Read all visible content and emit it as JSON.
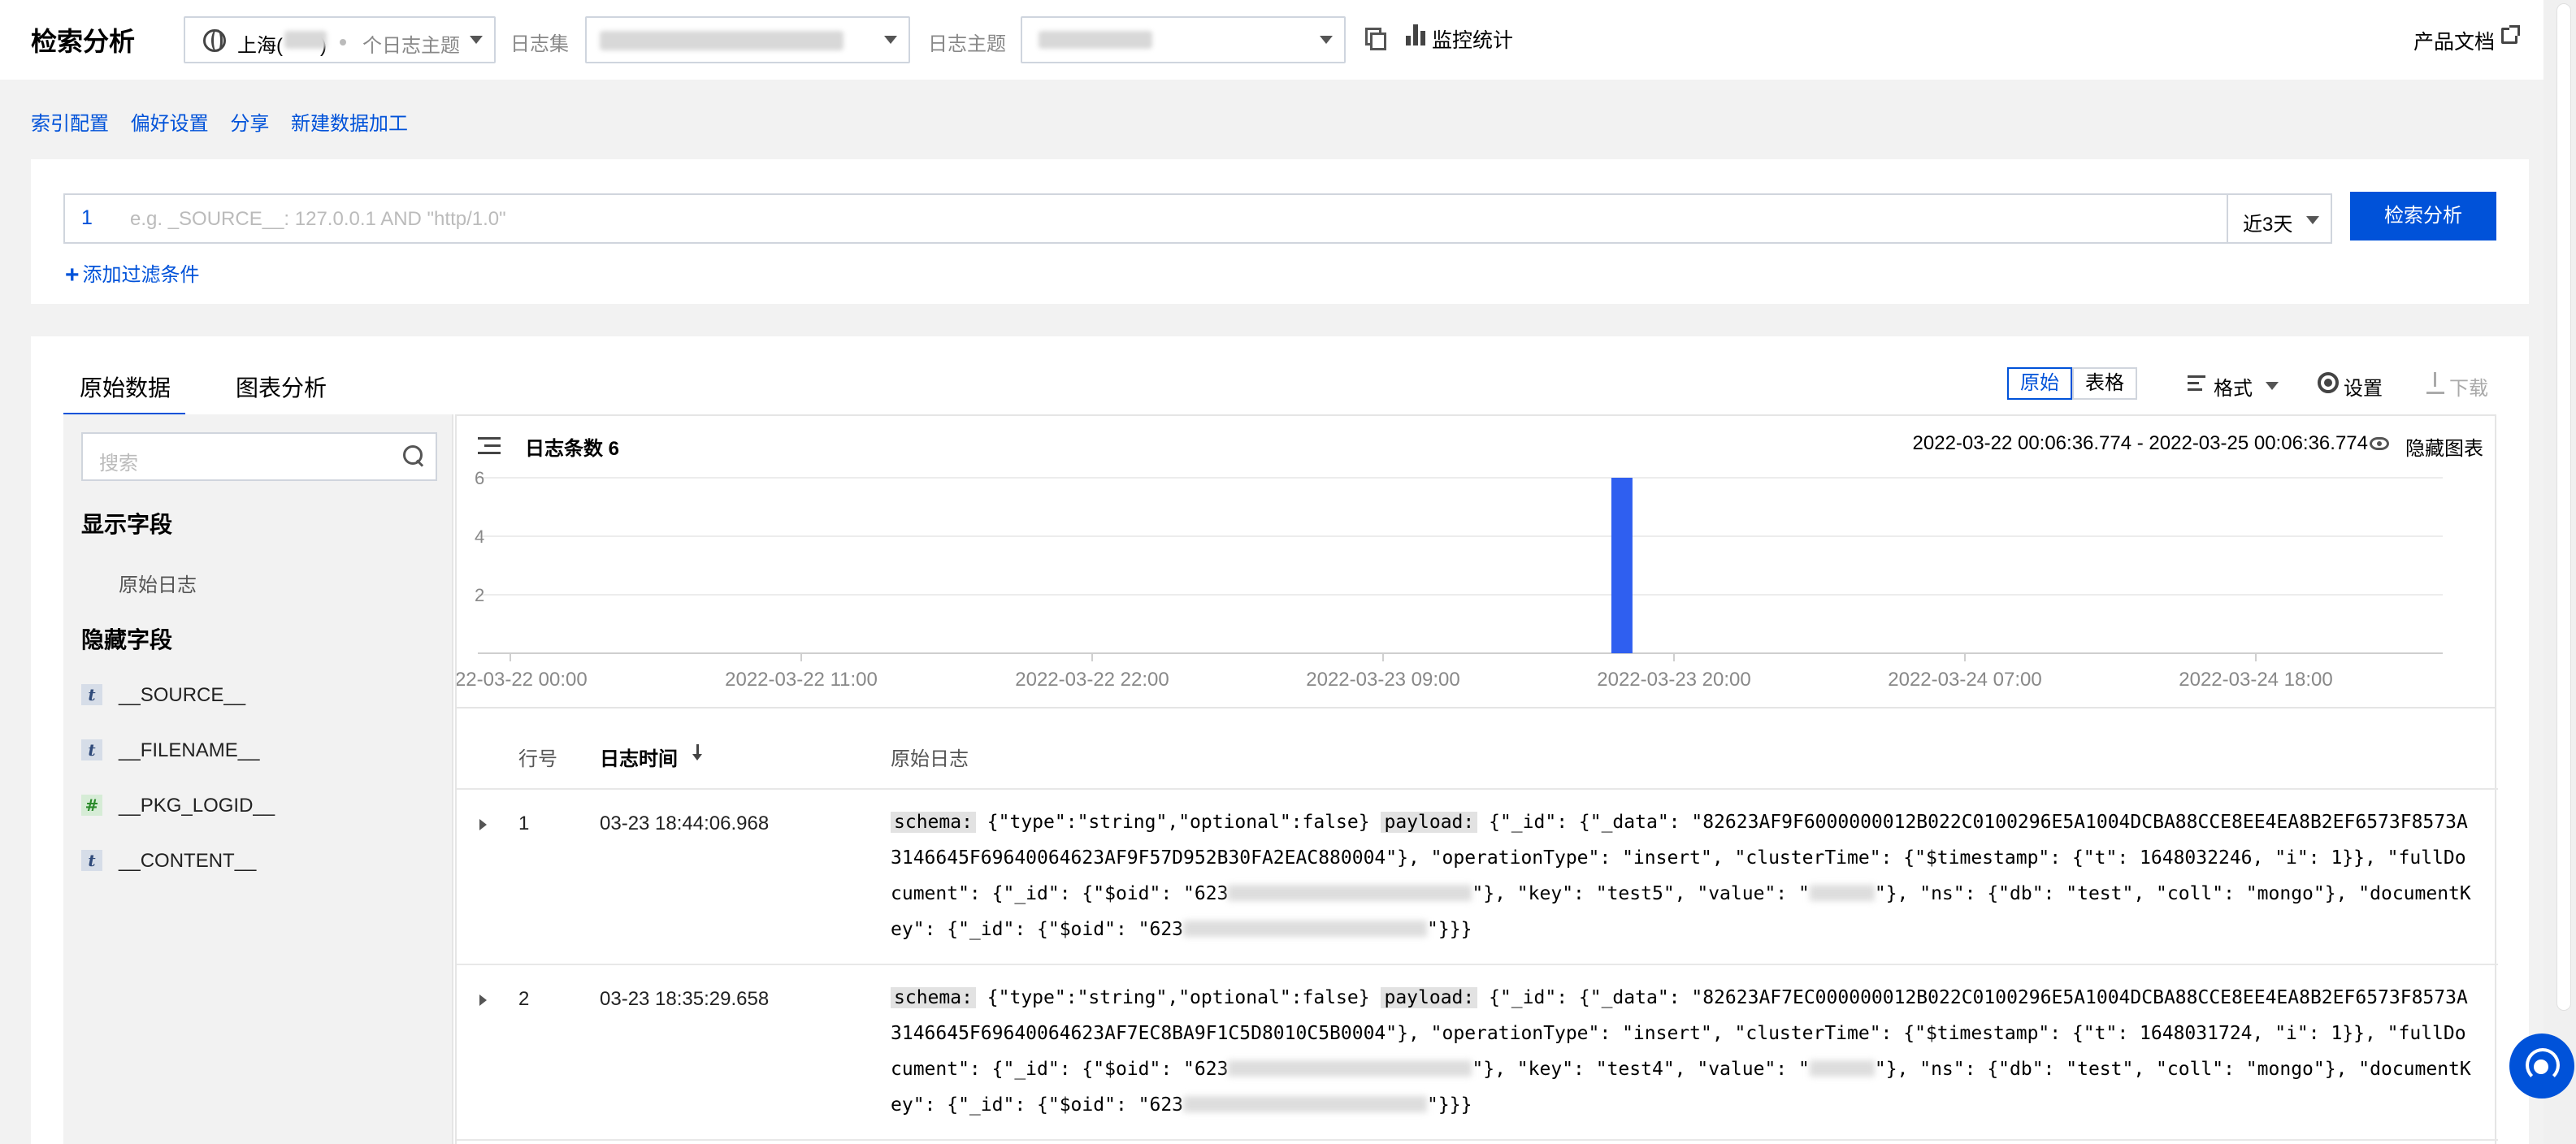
{
  "header": {
    "title": "检索分析",
    "region_label": "上海(",
    "region_label_close": ")",
    "topic_placeholder": "个日志主题",
    "logset_label": "日志集",
    "topic_label": "日志主题",
    "monitor_label": "监控统计",
    "docs_label": "产品文档"
  },
  "actions": {
    "index_config": "索引配置",
    "preferences": "偏好设置",
    "share": "分享",
    "new_processing": "新建数据加工"
  },
  "search": {
    "line_number": "1",
    "placeholder": "e.g. _SOURCE__: 127.0.0.1 AND \"http/1.0\"",
    "time_range": "近3天",
    "submit_label": "检索分析",
    "add_filter": "添加过滤条件"
  },
  "tabs": {
    "raw": "原始数据",
    "chart": "图表分析"
  },
  "toolbar": {
    "view_raw": "原始",
    "view_table": "表格",
    "format": "格式",
    "settings": "设置",
    "download": "下载"
  },
  "sidebar": {
    "search_placeholder": "搜索",
    "shown_heading": "显示字段",
    "shown_fields": [
      "原始日志"
    ],
    "hidden_heading": "隐藏字段",
    "hidden_fields": [
      {
        "type": "t",
        "name": "__SOURCE__"
      },
      {
        "type": "t",
        "name": "__FILENAME__"
      },
      {
        "type": "#",
        "name": "__PKG_LOGID__"
      },
      {
        "type": "t",
        "name": "__CONTENT__"
      }
    ]
  },
  "histogram": {
    "count_label": "日志条数 6",
    "time_range": "2022-03-22 00:06:36.774 - 2022-03-25 00:06:36.774",
    "hide_label": "隐藏图表",
    "bar_color": "#2f5ff0"
  },
  "chart_data": {
    "type": "bar",
    "x": [
      "2022-03-22 00:00",
      "2022-03-22 11:00",
      "2022-03-22 22:00",
      "2022-03-23 09:00",
      "2022-03-23 20:00",
      "2022-03-24 07:00",
      "2022-03-24 18:00"
    ],
    "ylim": [
      0,
      6
    ],
    "yticks": [
      2,
      4,
      6
    ],
    "bars": [
      {
        "x": "2022-03-23 18:00",
        "value": 6
      }
    ],
    "grid": true
  },
  "table": {
    "col_row": "行号",
    "col_time": "日志时间",
    "col_log": "原始日志",
    "rows": [
      {
        "no": "1",
        "time": "03-23 18:44:06.968",
        "schema_key": "schema:",
        "schema_val": "{\"type\":\"string\",\"optional\":false}",
        "payload_key": "payload:",
        "part1": "{\"_id\": {\"_data\": \"82623AF9F6000000012B022C0100296E5A1004DCBA88CCE8EE4EA8B2EF6573F8573A3146645F69640064623AF9F57D952B30FA2EAC880004\"}, \"operationType\": \"insert\", \"clusterTime\": {\"$timestamp\": {\"t\": 1648032246, \"i\": 1}}, \"fullDocument\": {\"_id\": {\"$oid\": \"623",
        "part2": "\"}, \"key\": \"test5\", \"value\": \"",
        "part3": "\"}, \"ns\": {\"db\": \"test\", \"coll\": \"mongo\"}, \"documentKey\": {\"_id\": {\"$oid\": \"623",
        "part4": "\"}}}"
      },
      {
        "no": "2",
        "time": "03-23 18:35:29.658",
        "schema_key": "schema:",
        "schema_val": "{\"type\":\"string\",\"optional\":false}",
        "payload_key": "payload:",
        "part1": "{\"_id\": {\"_data\": \"82623AF7EC000000012B022C0100296E5A1004DCBA88CCE8EE4EA8B2EF6573F8573A3146645F69640064623AF7EC8BA9F1C5D8010C5B0004\"}, \"operationType\": \"insert\", \"clusterTime\": {\"$timestamp\": {\"t\": 1648031724, \"i\": 1}}, \"fullDocument\": {\"_id\": {\"$oid\": \"623",
        "part2": "\"}, \"key\": \"test4\", \"value\": \"",
        "part3": "\"}, \"ns\": {\"db\": \"test\", \"coll\": \"mongo\"}, \"documentKey\": {\"_id\": {\"$oid\": \"623",
        "part4": "\"}}}"
      }
    ]
  }
}
